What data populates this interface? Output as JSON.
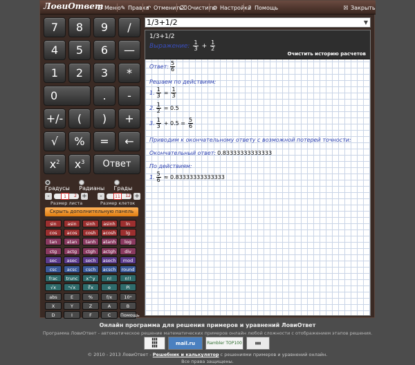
{
  "app": {
    "logo": "ЛовиОтвет"
  },
  "toolbar": {
    "menu": "Меню",
    "edit": "Правка",
    "undo": "Отменить",
    "clear": "Очистить",
    "settings": "Настройки",
    "help": "Помощь",
    "close": "Закрыть"
  },
  "keypad": {
    "k7": "7",
    "k8": "8",
    "k9": "9",
    "kdiv": "/",
    "k4": "4",
    "k5": "5",
    "k6": "6",
    "kfrac": "—",
    "k1": "1",
    "k2": "2",
    "k3": "3",
    "kmul": "*",
    "k0": "0",
    "kdot": ".",
    "kminus": "-",
    "kneg": "+/-",
    "klp": "(",
    "krp": ")",
    "kplus": "+",
    "ksqrt": "√",
    "kpct": "%",
    "keq": "=",
    "kback": "←",
    "kx": "x",
    "kpow2": "2",
    "kpow3": "3",
    "kanswer": "Ответ"
  },
  "units": {
    "deg": "Градусы",
    "rad": "Радианы",
    "grad": "Грады"
  },
  "sizers": {
    "sheet_label": "Размер листа",
    "sheet_value": "1",
    "sheet_max": "2",
    "cell_label": "Размер клеток",
    "cell_value": "11",
    "cell_max": "12"
  },
  "toggle_panel": "Скрыть дополнительную панель",
  "funcs": [
    "sin",
    "asin",
    "sinh",
    "asinh",
    "ln",
    "cos",
    "acos",
    "cosh",
    "acosh",
    "lg",
    "tan",
    "atan",
    "tanh",
    "atanh",
    "log",
    "ctg",
    "actg",
    "ctgh",
    "actgh",
    "div",
    "sec",
    "asec",
    "sech",
    "asech",
    "mod",
    "csc",
    "acsc",
    "csch",
    "acsch",
    "round",
    "frac",
    "trunc",
    "x^y",
    "n!",
    "n!!",
    "√x",
    "ⁿ√x",
    "∛x",
    "e",
    "Pi",
    "abs",
    "E",
    "%",
    "f/x",
    "10ˣ",
    "X",
    "Y",
    "Z",
    "A",
    "B",
    "D",
    "I",
    "F",
    "C",
    "Помощь"
  ],
  "expression": {
    "value": "1/3+1/2"
  },
  "history": {
    "entry": "1/3+1/2",
    "label": "Выражение:",
    "clear": "Очистить историю расчетов"
  },
  "result": {
    "answer_label": "Ответ:",
    "answer_num": "5",
    "answer_den": "6",
    "steps_title": "Решаем по действиям:",
    "s1_idx": "1.",
    "s2_idx": "2.",
    "s3_idx": "3.",
    "one": "1",
    "three": "3",
    "two": "2",
    "s2_val": "= 0.5",
    "s3_plus": "+ 0.5 =",
    "approx_title": "Приводим к окончательному ответу с возможной потерей точности:",
    "final_label": "Окончательный ответ:",
    "final_value": "0.83333333333333",
    "by_steps": "По действиям:",
    "approx": "≈ 0.83333333333333"
  },
  "footer": {
    "title": "Онлайн программа для решения примеров и уравнений ЛовиОтвет",
    "desc": "Программа ЛовиОтвет - автоматическое решение математических примеров онлайн любой сложности с отображением этапов решения.",
    "badge_mail": "mail.ru",
    "badge_rambler": "Rambler TOP100",
    "copyright_pre": "© 2010 - 2013 ЛовиОтвет - ",
    "copyright_link": "Решебник и калькулятор",
    "copyright_post": " с решениями примеров и уравнений онлайн.",
    "rights": "Все права защищены."
  }
}
